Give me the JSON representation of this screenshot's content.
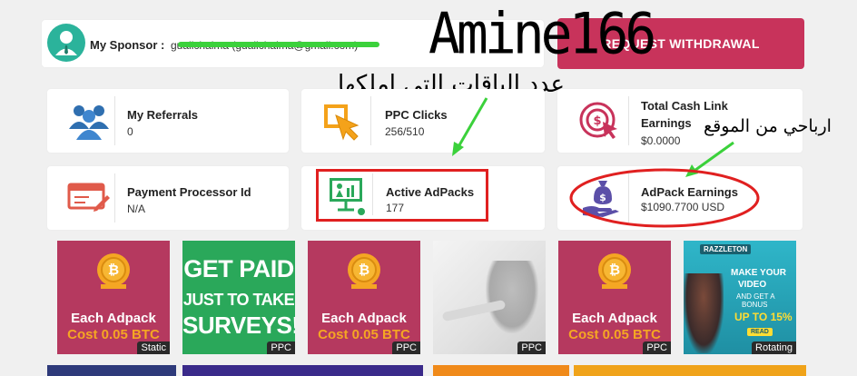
{
  "sponsor": {
    "label": "My Sponsor :",
    "value": "gualichaima (gualichaima@gmail.com)"
  },
  "withdraw_button": {
    "label": "REQUEST WITHDRAWAL"
  },
  "overlay": {
    "username": "Amine166",
    "packs_note": "عدد الباقات التي املكها",
    "earnings_note": "ارباحي من الموقع"
  },
  "stats": {
    "referrals": {
      "title": "My Referrals",
      "value": "0"
    },
    "ppc_clicks": {
      "title": "PPC Clicks",
      "value": "256/510"
    },
    "cash_link": {
      "title_line1": "Total Cash Link",
      "title_line2": "Earnings",
      "value": "$0.0000"
    },
    "payment": {
      "title": "Payment Processor Id",
      "value": "N/A"
    },
    "adpacks": {
      "title": "Active AdPacks",
      "value": "177"
    },
    "adpack_earnings": {
      "title": "AdPack Earnings",
      "value": "$1090.7700 USD"
    }
  },
  "ads": [
    {
      "line1": "Each Adpack",
      "line2": "Cost 0.05 BTC",
      "tag": "Static"
    },
    {
      "line1": "GET PAID",
      "line2": "JUST TO TAKE",
      "line3": "SURVEYS!",
      "tag": "PPC"
    },
    {
      "line1": "Each Adpack",
      "line2": "Cost 0.05 BTC",
      "tag": "PPC"
    },
    {
      "tag": "PPC"
    },
    {
      "line1": "Each Adpack",
      "line2": "Cost 0.05 BTC",
      "tag": "PPC"
    },
    {
      "brand": "RAZZLETON",
      "line1": "MAKE YOUR",
      "line2": "VIDEO",
      "line3": "AND GET A",
      "line4": "BONUS",
      "line5": "UP TO 15%",
      "line6": "READ",
      "tag": "Rotating"
    }
  ],
  "colors": {
    "accent": "#c8335b",
    "ad_bg": "#b5395f",
    "btc_gold": "#f5a623",
    "cash_yellow": "#f9d03f",
    "survey_green": "#2aa85a",
    "annotation_red": "#e02020",
    "annotation_green": "#3bd13b"
  }
}
